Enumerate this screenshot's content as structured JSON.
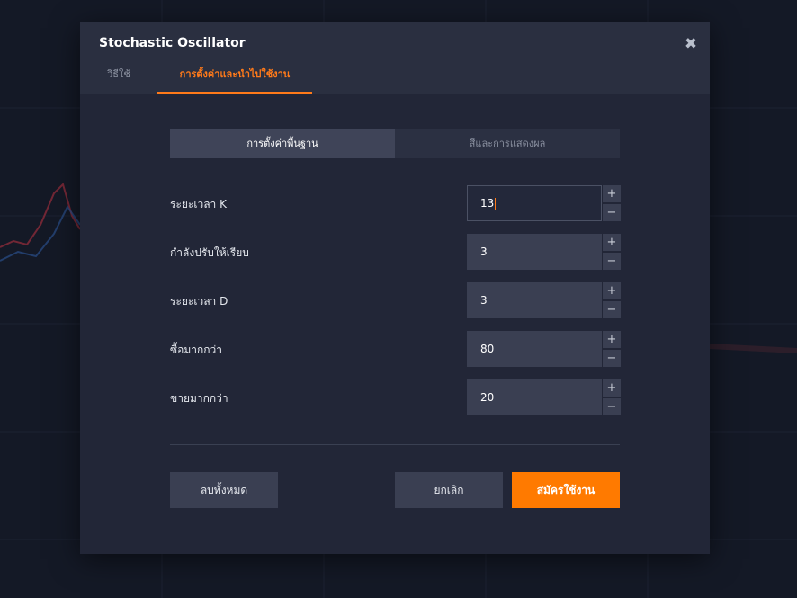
{
  "dialog": {
    "title": "Stochastic Oscillator",
    "close_glyph": "✖"
  },
  "tabs": [
    {
      "label": "วิธีใช้",
      "active": false
    },
    {
      "label": "การตั้งค่าและนำไปใช้งาน",
      "active": true
    }
  ],
  "subtabs": [
    {
      "label": "การตั้งค่าพื้นฐาน",
      "active": true
    },
    {
      "label": "สีและการแสดงผล",
      "active": false
    }
  ],
  "fields": [
    {
      "label": "ระยะเวลา K",
      "value": "13",
      "focused": true
    },
    {
      "label": "กำลังปรับให้เรียบ",
      "value": "3"
    },
    {
      "label": "ระยะเวลา D",
      "value": "3"
    },
    {
      "label": "ซื้อมากกว่า",
      "value": "80"
    },
    {
      "label": "ขายมากกว่า",
      "value": "20"
    }
  ],
  "stepper": {
    "plus": "+",
    "minus": "−"
  },
  "buttons": {
    "reset": "ลบทั้งหมด",
    "cancel": "ยกเลิก",
    "apply": "สมัครใช้งาน"
  },
  "colors": {
    "accent": "#ff7a00",
    "modal_bg": "#222637",
    "header_bg": "#2a2f40",
    "page_bg": "#141926"
  },
  "icons": [
    "close-icon",
    "plus-icon",
    "minus-icon"
  ]
}
